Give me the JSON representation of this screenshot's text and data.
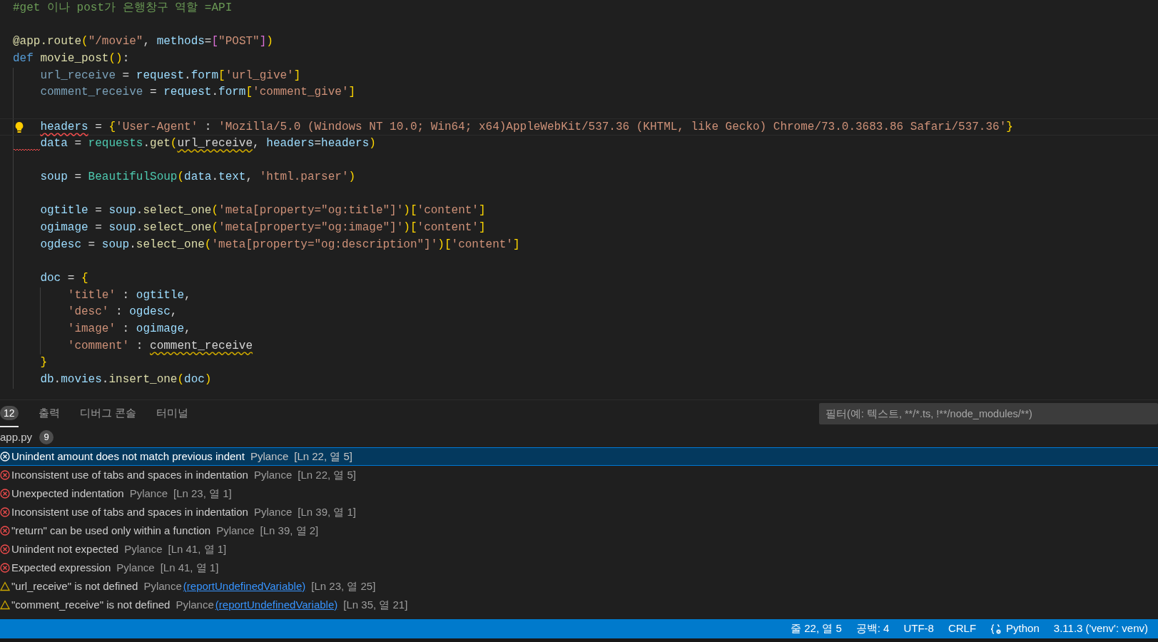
{
  "editor": {
    "lines": [
      {
        "kind": "top",
        "tokens": [
          {
            "text": "#get 이나 post가 은행창구 역할 =API",
            "kind": "comment"
          }
        ]
      },
      {
        "kind": "blank"
      },
      {
        "kind": "top",
        "tokens": [
          {
            "text": "@app.route",
            "kind": "function"
          },
          {
            "text": "(",
            "kind": "bracket1"
          },
          {
            "text": "\"/movie\"",
            "kind": "string"
          },
          {
            "text": ", ",
            "kind": "plain"
          },
          {
            "text": "methods",
            "kind": "variable"
          },
          {
            "text": "=",
            "kind": "plain"
          },
          {
            "text": "[",
            "kind": "bracket2"
          },
          {
            "text": "\"POST\"",
            "kind": "string"
          },
          {
            "text": "]",
            "kind": "bracket2"
          },
          {
            "text": ")",
            "kind": "bracket1"
          }
        ]
      },
      {
        "kind": "top",
        "tokens": [
          {
            "text": "def ",
            "kind": "keyword"
          },
          {
            "text": "movie_post",
            "kind": "function"
          },
          {
            "text": "()",
            "kind": "bracket1"
          },
          {
            "text": ":",
            "kind": "plain"
          }
        ]
      },
      {
        "kind": "body",
        "tokens": [
          {
            "text": "url_receive",
            "kind": "unused"
          },
          {
            "text": " = ",
            "kind": "plain"
          },
          {
            "text": "request",
            "kind": "variable"
          },
          {
            "text": ".",
            "kind": "plain"
          },
          {
            "text": "form",
            "kind": "variable"
          },
          {
            "text": "[",
            "kind": "bracket1"
          },
          {
            "text": "'url_give'",
            "kind": "string"
          },
          {
            "text": "]",
            "kind": "bracket1"
          }
        ]
      },
      {
        "kind": "body",
        "tokens": [
          {
            "text": "comment_receive",
            "kind": "unused"
          },
          {
            "text": " = ",
            "kind": "plain"
          },
          {
            "text": "request",
            "kind": "variable"
          },
          {
            "text": ".",
            "kind": "plain"
          },
          {
            "text": "form",
            "kind": "variable"
          },
          {
            "text": "[",
            "kind": "bracket1"
          },
          {
            "text": "'comment_give'",
            "kind": "string"
          },
          {
            "text": "]",
            "kind": "bracket1"
          }
        ]
      },
      {
        "kind": "blank"
      },
      {
        "kind": "body",
        "highlighted": true,
        "lightbulb": true,
        "tokens": [
          {
            "text": "headers",
            "kind": "variable",
            "error_underline": true
          },
          {
            "text": " = ",
            "kind": "plain"
          },
          {
            "text": "{",
            "kind": "bracket1"
          },
          {
            "text": "'User-Agent'",
            "kind": "string"
          },
          {
            "text": " : ",
            "kind": "plain"
          },
          {
            "text": "'Mozilla/5.0 (Windows NT 10.0; Win64; x64)AppleWebKit/537.36 (KHTML, like Gecko) Chrome/73.0.3683.86 Safari/537.36'",
            "kind": "string"
          },
          {
            "text": "}",
            "kind": "bracket1"
          }
        ]
      },
      {
        "kind": "body",
        "margin_error_underline": true,
        "tokens": [
          {
            "text": "data",
            "kind": "variable"
          },
          {
            "text": " = ",
            "kind": "plain"
          },
          {
            "text": "requests",
            "kind": "class"
          },
          {
            "text": ".",
            "kind": "plain"
          },
          {
            "text": "get",
            "kind": "function"
          },
          {
            "text": "(",
            "kind": "bracket1"
          },
          {
            "text": "url_receive",
            "kind": "plain",
            "warning_underline": true
          },
          {
            "text": ", ",
            "kind": "plain"
          },
          {
            "text": "headers",
            "kind": "variable"
          },
          {
            "text": "=",
            "kind": "plain"
          },
          {
            "text": "headers",
            "kind": "variable"
          },
          {
            "text": ")",
            "kind": "bracket1"
          }
        ]
      },
      {
        "kind": "blank"
      },
      {
        "kind": "body",
        "tokens": [
          {
            "text": "soup",
            "kind": "variable"
          },
          {
            "text": " = ",
            "kind": "plain"
          },
          {
            "text": "BeautifulSoup",
            "kind": "class"
          },
          {
            "text": "(",
            "kind": "bracket1"
          },
          {
            "text": "data",
            "kind": "variable"
          },
          {
            "text": ".",
            "kind": "plain"
          },
          {
            "text": "text",
            "kind": "variable"
          },
          {
            "text": ", ",
            "kind": "plain"
          },
          {
            "text": "'html.parser'",
            "kind": "string"
          },
          {
            "text": ")",
            "kind": "bracket1"
          }
        ]
      },
      {
        "kind": "blank"
      },
      {
        "kind": "body",
        "tokens": [
          {
            "text": "ogtitle",
            "kind": "variable"
          },
          {
            "text": " = ",
            "kind": "plain"
          },
          {
            "text": "soup",
            "kind": "variable"
          },
          {
            "text": ".",
            "kind": "plain"
          },
          {
            "text": "select_one",
            "kind": "function"
          },
          {
            "text": "(",
            "kind": "bracket1"
          },
          {
            "text": "'meta[property=\"og:title\"]'",
            "kind": "string"
          },
          {
            "text": ")",
            "kind": "bracket1"
          },
          {
            "text": "[",
            "kind": "bracket1"
          },
          {
            "text": "'content'",
            "kind": "string"
          },
          {
            "text": "]",
            "kind": "bracket1"
          }
        ]
      },
      {
        "kind": "body",
        "tokens": [
          {
            "text": "ogimage",
            "kind": "variable"
          },
          {
            "text": " = ",
            "kind": "plain"
          },
          {
            "text": "soup",
            "kind": "variable"
          },
          {
            "text": ".",
            "kind": "plain"
          },
          {
            "text": "select_one",
            "kind": "function"
          },
          {
            "text": "(",
            "kind": "bracket1"
          },
          {
            "text": "'meta[property=\"og:image\"]'",
            "kind": "string"
          },
          {
            "text": ")",
            "kind": "bracket1"
          },
          {
            "text": "[",
            "kind": "bracket1"
          },
          {
            "text": "'content'",
            "kind": "string"
          },
          {
            "text": "]",
            "kind": "bracket1"
          }
        ]
      },
      {
        "kind": "body",
        "tokens": [
          {
            "text": "ogdesc",
            "kind": "variable"
          },
          {
            "text": " = ",
            "kind": "plain"
          },
          {
            "text": "soup",
            "kind": "variable"
          },
          {
            "text": ".",
            "kind": "plain"
          },
          {
            "text": "select_one",
            "kind": "function"
          },
          {
            "text": "(",
            "kind": "bracket1"
          },
          {
            "text": "'meta[property=\"og:description\"]'",
            "kind": "string"
          },
          {
            "text": ")",
            "kind": "bracket1"
          },
          {
            "text": "[",
            "kind": "bracket1"
          },
          {
            "text": "'content'",
            "kind": "string"
          },
          {
            "text": "]",
            "kind": "bracket1"
          }
        ]
      },
      {
        "kind": "blank"
      },
      {
        "kind": "body",
        "tokens": [
          {
            "text": "doc",
            "kind": "variable"
          },
          {
            "text": " = ",
            "kind": "plain"
          },
          {
            "text": "{",
            "kind": "bracket1"
          }
        ]
      },
      {
        "kind": "nested",
        "tokens": [
          {
            "text": "'title'",
            "kind": "string"
          },
          {
            "text": " : ",
            "kind": "plain"
          },
          {
            "text": "ogtitle",
            "kind": "variable"
          },
          {
            "text": ",",
            "kind": "plain"
          }
        ]
      },
      {
        "kind": "nested",
        "tokens": [
          {
            "text": "'desc'",
            "kind": "string"
          },
          {
            "text": " : ",
            "kind": "plain"
          },
          {
            "text": "ogdesc",
            "kind": "variable"
          },
          {
            "text": ",",
            "kind": "plain"
          }
        ]
      },
      {
        "kind": "nested",
        "tokens": [
          {
            "text": "'image'",
            "kind": "string"
          },
          {
            "text": " : ",
            "kind": "plain"
          },
          {
            "text": "ogimage",
            "kind": "variable"
          },
          {
            "text": ",",
            "kind": "plain"
          }
        ]
      },
      {
        "kind": "nested",
        "tokens": [
          {
            "text": "'comment'",
            "kind": "string"
          },
          {
            "text": " : ",
            "kind": "plain"
          },
          {
            "text": "comment_receive",
            "kind": "plain",
            "warning_underline": true
          }
        ]
      },
      {
        "kind": "body",
        "tokens": [
          {
            "text": "}",
            "kind": "bracket1"
          }
        ]
      },
      {
        "kind": "body",
        "tokens": [
          {
            "text": "db",
            "kind": "variable"
          },
          {
            "text": ".",
            "kind": "plain"
          },
          {
            "text": "movies",
            "kind": "variable"
          },
          {
            "text": ".",
            "kind": "plain"
          },
          {
            "text": "insert_one",
            "kind": "function"
          },
          {
            "text": "(",
            "kind": "bracket1"
          },
          {
            "text": "doc",
            "kind": "variable"
          },
          {
            "text": ")",
            "kind": "bracket1"
          }
        ]
      }
    ]
  },
  "panel": {
    "tabs": [
      {
        "label": "12",
        "kind": "badge",
        "selected": true
      },
      {
        "label": "출력",
        "kind": "text",
        "selected": false
      },
      {
        "label": "디버그 콘솔",
        "kind": "text",
        "selected": false
      },
      {
        "label": "터미널",
        "kind": "text",
        "selected": false
      }
    ],
    "filter": {
      "placeholder": "필터(예: 텍스트, **/*.ts, !**/node_modules/**)"
    },
    "file": {
      "name": "app.py",
      "count": "9"
    },
    "problems": [
      {
        "kind": "error",
        "selected": true,
        "message": "Unindent amount does not match previous indent",
        "source": "Pylance",
        "location": "[Ln 22, 열 5]"
      },
      {
        "kind": "error",
        "selected": false,
        "message": "Inconsistent use of tabs and spaces in indentation",
        "source": "Pylance",
        "location": "[Ln 22, 열 5]"
      },
      {
        "kind": "error",
        "selected": false,
        "message": "Unexpected indentation",
        "source": "Pylance",
        "location": "[Ln 23, 열 1]"
      },
      {
        "kind": "error",
        "selected": false,
        "message": "Inconsistent use of tabs and spaces in indentation",
        "source": "Pylance",
        "location": "[Ln 39, 열 1]"
      },
      {
        "kind": "error",
        "selected": false,
        "message": "\"return\" can be used only within a function",
        "source": "Pylance",
        "location": "[Ln 39, 열 2]"
      },
      {
        "kind": "error",
        "selected": false,
        "message": "Unindent not expected",
        "source": "Pylance",
        "location": "[Ln 41, 열 1]"
      },
      {
        "kind": "error",
        "selected": false,
        "message": "Expected expression",
        "source": "Pylance",
        "location": "[Ln 41, 열 1]"
      },
      {
        "kind": "warning",
        "selected": false,
        "message": "\"url_receive\" is not defined",
        "source": "Pylance",
        "link": "(reportUndefinedVariable)",
        "location": "[Ln 23, 열 25]"
      },
      {
        "kind": "warning",
        "selected": false,
        "message": "\"comment_receive\" is not defined",
        "source": "Pylance",
        "link": "(reportUndefinedVariable)",
        "location": "[Ln 35, 열 21]"
      }
    ]
  },
  "status_bar": {
    "items": [
      {
        "text": "줄 22, 열 5",
        "kind": "text"
      },
      {
        "text": "공백: 4",
        "kind": "text"
      },
      {
        "text": "UTF-8",
        "kind": "text"
      },
      {
        "text": "CRLF",
        "kind": "text"
      },
      {
        "text": "Python",
        "kind": "language"
      },
      {
        "text": "3.11.3 ('venv': venv)",
        "kind": "text"
      }
    ]
  }
}
